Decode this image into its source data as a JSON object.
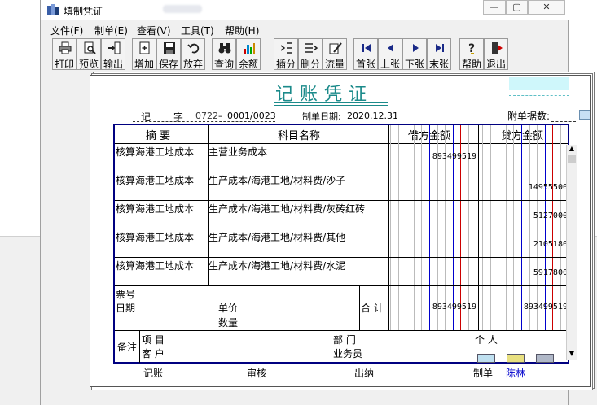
{
  "window": {
    "title": "填制凭证",
    "min_glyph": "—",
    "max_glyph": "▢",
    "close_glyph": "✕"
  },
  "menu": [
    "文件(F)",
    "制单(E)",
    "查看(V)",
    "工具(T)",
    "帮助(H)"
  ],
  "toolbar": [
    {
      "label": "打印",
      "icon": "printer-icon"
    },
    {
      "label": "预览",
      "icon": "preview-icon"
    },
    {
      "label": "输出",
      "icon": "export-icon"
    },
    {
      "label": "增加",
      "icon": "add-icon"
    },
    {
      "label": "保存",
      "icon": "save-icon"
    },
    {
      "label": "放弃",
      "icon": "undo-icon"
    },
    {
      "label": "查询",
      "icon": "binoculars-icon"
    },
    {
      "label": "余额",
      "icon": "balance-chart-icon"
    },
    {
      "label": "插分",
      "icon": "insert-row-icon"
    },
    {
      "label": "删分",
      "icon": "delete-row-icon"
    },
    {
      "label": "流量",
      "icon": "cashflow-icon"
    },
    {
      "label": "首张",
      "icon": "first-icon"
    },
    {
      "label": "上张",
      "icon": "prev-icon"
    },
    {
      "label": "下张",
      "icon": "next-icon"
    },
    {
      "label": "末张",
      "icon": "last-icon"
    },
    {
      "label": "帮助",
      "icon": "help-icon"
    },
    {
      "label": "退出",
      "icon": "exit-icon"
    }
  ],
  "voucher": {
    "title": "记账凭证",
    "type_label": "记",
    "zi_label": "字",
    "code": "0722",
    "dash": "–",
    "number": "0001/0023",
    "date_label": "制单日期:",
    "date": "2020.12.31",
    "attachments_label": "附单据数:",
    "columns": {
      "summary": "摘  要",
      "account": "科目名称",
      "debit": "借方金额",
      "credit": "贷方金额"
    },
    "rows": [
      {
        "summary": "核算海港工地成本",
        "account": "主营业务成本",
        "debit": "893499519",
        "credit": ""
      },
      {
        "summary": "核算海港工地成本",
        "account": "生产成本/海港工地/材料费/沙子",
        "debit": "",
        "credit": "14955500"
      },
      {
        "summary": "核算海港工地成本",
        "account": "生产成本/海港工地/材料费/灰砖红砖",
        "debit": "",
        "credit": "5127000"
      },
      {
        "summary": "核算海港工地成本",
        "account": "生产成本/海港工地/材料费/其他",
        "debit": "",
        "credit": "2105180"
      },
      {
        "summary": "核算海港工地成本",
        "account": "生产成本/海港工地/材料费/水泥",
        "debit": "",
        "credit": "5917800"
      }
    ],
    "bill_no_label": "票号",
    "date_field_label": "日期",
    "unit_price_label": "单价",
    "quantity_label": "数量",
    "total_label": "合  计",
    "total_debit": "893499519",
    "total_credit": "893499519",
    "remarks_label": "备注",
    "project_label": "项  目",
    "customer_label": "客  户",
    "dept_label": "部  门",
    "person_label": "个  人",
    "salesman_label": "业务员",
    "bookkeeper_label": "记账",
    "reviewer_label": "审核",
    "cashier_label": "出纳",
    "maker_label": "制单",
    "maker_name": "陈林"
  },
  "colors": {
    "title": "#1b8a8a",
    "grid_border": "#000080",
    "debit_line": "#0000cc",
    "credit_line": "#cc0000",
    "maker_name": "#0000cc"
  }
}
